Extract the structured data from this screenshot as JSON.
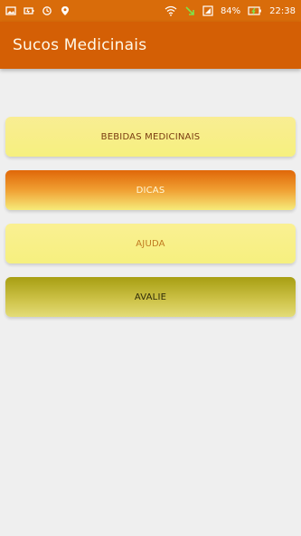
{
  "status_bar": {
    "battery_percent": "84%",
    "time": "22:38",
    "icons": [
      "image-icon",
      "battery-saver-icon",
      "sync-icon",
      "location-icon",
      "wifi-icon",
      "download-icon",
      "signal-icon",
      "battery-charging-icon"
    ]
  },
  "app_bar": {
    "title": "Sucos Medicinais",
    "color": "#d45f05"
  },
  "menu": {
    "items": [
      {
        "label": "BEBIDAS MEDICINAIS"
      },
      {
        "label": "DICAS"
      },
      {
        "label": "AJUDA"
      },
      {
        "label": "AVALIE"
      }
    ]
  }
}
